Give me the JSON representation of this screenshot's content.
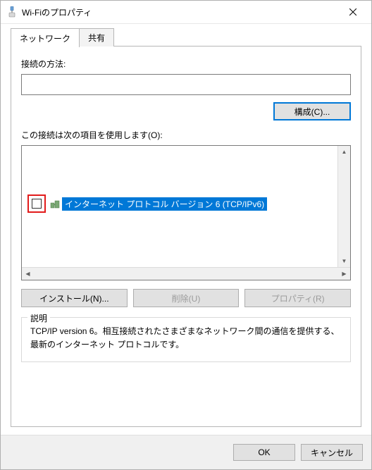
{
  "window": {
    "title": "Wi-Fiのプロパティ"
  },
  "tabs": {
    "network": "ネットワーク",
    "sharing": "共有"
  },
  "labels": {
    "connect_using": "接続の方法:",
    "items_used": "この接続は次の項目を使用します(O):"
  },
  "buttons": {
    "configure": "構成(C)...",
    "install": "インストール(N)...",
    "uninstall": "削除(U)",
    "properties": "プロパティ(R)",
    "ok": "OK",
    "cancel": "キャンセル"
  },
  "list": {
    "selected_item": "インターネット プロトコル バージョン 6 (TCP/IPv6)"
  },
  "description": {
    "title": "説明",
    "body": "TCP/IP version 6。相互接続されたさまざまなネットワーク間の通信を提供する、最新のインターネット プロトコルです。"
  }
}
